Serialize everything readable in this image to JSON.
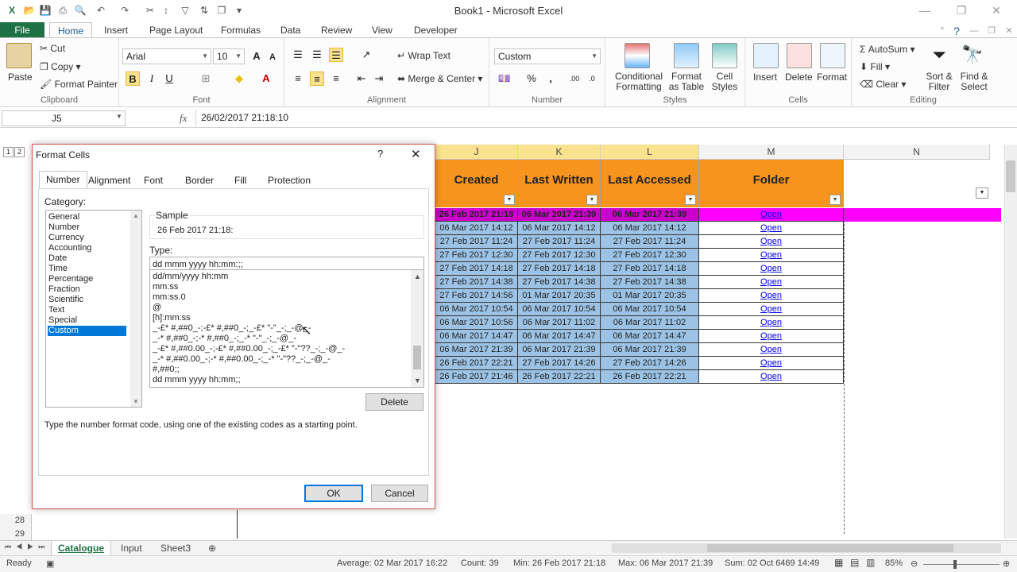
{
  "window": {
    "title": "Book1 - Microsoft Excel"
  },
  "tabs": [
    "File",
    "Home",
    "Insert",
    "Page Layout",
    "Formulas",
    "Data",
    "Review",
    "View",
    "Developer"
  ],
  "ribbon": {
    "clipboard": {
      "paste": "Paste",
      "cut": "Cut",
      "copy": "Copy",
      "format_painter": "Format Painter",
      "label": "Clipboard"
    },
    "font": {
      "name": "Arial",
      "size": "10",
      "label": "Font",
      "bold": "B",
      "italic": "I",
      "underline": "U"
    },
    "alignment": {
      "wrap": "Wrap Text",
      "merge": "Merge & Center",
      "label": "Alignment"
    },
    "number": {
      "format": "Custom",
      "label": "Number"
    },
    "styles": {
      "conditional": "Conditional Formatting",
      "format_table": "Format as Table",
      "cell_styles": "Cell Styles",
      "label": "Styles"
    },
    "cells": {
      "insert": "Insert",
      "delete": "Delete",
      "format": "Format",
      "label": "Cells"
    },
    "editing": {
      "autosum": "AutoSum",
      "fill": "Fill",
      "clear": "Clear",
      "sort": "Sort & Filter",
      "find": "Find & Select",
      "label": "Editing"
    }
  },
  "formula_bar": {
    "name_box": "J5",
    "fx": "fx",
    "value": "26/02/2017  21:18:10"
  },
  "columns": {
    "J": {
      "letter": "J",
      "header": "Created"
    },
    "K": {
      "letter": "K",
      "header": "Last Written"
    },
    "L": {
      "letter": "L",
      "header": "Last Accessed"
    },
    "M": {
      "letter": "M",
      "header": "Folder"
    },
    "N": {
      "letter": "N",
      "header": ""
    }
  },
  "rows": [
    {
      "created": "26 Feb 2017 21:18",
      "written": "06 Mar 2017 21:39",
      "accessed": "06 Mar 2017 21:39",
      "folder": "Open"
    },
    {
      "created": "06 Mar 2017 14:12",
      "written": "06 Mar 2017 14:12",
      "accessed": "06 Mar 2017 14:12",
      "folder": "Open"
    },
    {
      "created": "27 Feb 2017 11:24",
      "written": "27 Feb 2017 11:24",
      "accessed": "27 Feb 2017 11:24",
      "folder": "Open"
    },
    {
      "created": "27 Feb 2017 12:30",
      "written": "27 Feb 2017 12:30",
      "accessed": "27 Feb 2017 12:30",
      "folder": "Open"
    },
    {
      "created": "27 Feb 2017 14:18",
      "written": "27 Feb 2017 14:18",
      "accessed": "27 Feb 2017 14:18",
      "folder": "Open"
    },
    {
      "created": "27 Feb 2017 14:38",
      "written": "27 Feb 2017 14:38",
      "accessed": "27 Feb 2017 14:38",
      "folder": "Open"
    },
    {
      "created": "27 Feb 2017 14:56",
      "written": "01 Mar 2017 20:35",
      "accessed": "01 Mar 2017 20:35",
      "folder": "Open"
    },
    {
      "created": "06 Mar 2017 10:54",
      "written": "06 Mar 2017 10:54",
      "accessed": "06 Mar 2017 10:54",
      "folder": "Open"
    },
    {
      "created": "06 Mar 2017 10:56",
      "written": "06 Mar 2017 11:02",
      "accessed": "06 Mar 2017 11:02",
      "folder": "Open"
    },
    {
      "created": "06 Mar 2017 14:47",
      "written": "06 Mar 2017 14:47",
      "accessed": "06 Mar 2017 14:47",
      "folder": "Open"
    },
    {
      "created": "06 Mar 2017 21:39",
      "written": "06 Mar 2017 21:39",
      "accessed": "06 Mar 2017 21:39",
      "folder": "Open"
    },
    {
      "created": "26 Feb 2017 22:21",
      "written": "27 Feb 2017 14:26",
      "accessed": "27 Feb 2017 14:26",
      "folder": "Open"
    },
    {
      "created": "26 Feb 2017 21:46",
      "written": "26 Feb 2017 22:21",
      "accessed": "26 Feb 2017 22:21",
      "folder": "Open"
    }
  ],
  "row_numbers": [
    "28",
    "29"
  ],
  "outline_levels": [
    "1",
    "2"
  ],
  "dialog": {
    "title": "Format Cells",
    "help": "?",
    "close": "✕",
    "tabs": [
      "Number",
      "Alignment",
      "Font",
      "Border",
      "Fill",
      "Protection"
    ],
    "category_label": "Category:",
    "categories": [
      "General",
      "Number",
      "Currency",
      "Accounting",
      "Date",
      "Time",
      "Percentage",
      "Fraction",
      "Scientific",
      "Text",
      "Special",
      "Custom"
    ],
    "selected_category": "Custom",
    "sample_label": "Sample",
    "sample_value": "26 Feb 2017 21:18:",
    "type_label": "Type:",
    "type_value": "dd mmm yyyy hh:mm:;;",
    "formats": [
      "dd/mm/yyyy hh:mm",
      "mm:ss",
      "mm:ss.0",
      "@",
      "[h]:mm:ss",
      "_-£* #,##0_-;-£* #,##0_-;_-£* \"-\"_-;_-@_-",
      "_-* #,##0_-;-* #,##0_-;_-* \"-\"_-;_-@_-",
      "_-£* #,##0.00_-;-£* #,##0.00_-;_-£* \"-\"??_-;_-@_-",
      "_-* #,##0.00_-;-* #,##0.00_-;_-* \"-\"??_-;_-@_-",
      "#,##0;;",
      "dd mmm yyyy hh:mm;;"
    ],
    "delete_label": "Delete",
    "hint": "Type the number format code, using one of the existing codes as a starting point.",
    "ok_label": "OK",
    "cancel_label": "Cancel"
  },
  "sheets": [
    "Catalogue",
    "Input",
    "Sheet3"
  ],
  "active_sheet": "Catalogue",
  "status": {
    "ready": "Ready",
    "average": "Average: 02 Mar 2017 16:22",
    "count": "Count: 39",
    "min": "Min: 26 Feb 2017 21:18",
    "max": "Max: 06 Mar 2017 21:39",
    "sum": "Sum: 02 Oct 6469 14:49",
    "zoom": "85%"
  },
  "colors": {
    "excel_green": "#1e7145",
    "header_orange": "#f7941d",
    "row_blue": "#9cc3e5",
    "highlight_pink": "#ff00ff",
    "accent_blue": "#0078d7"
  }
}
